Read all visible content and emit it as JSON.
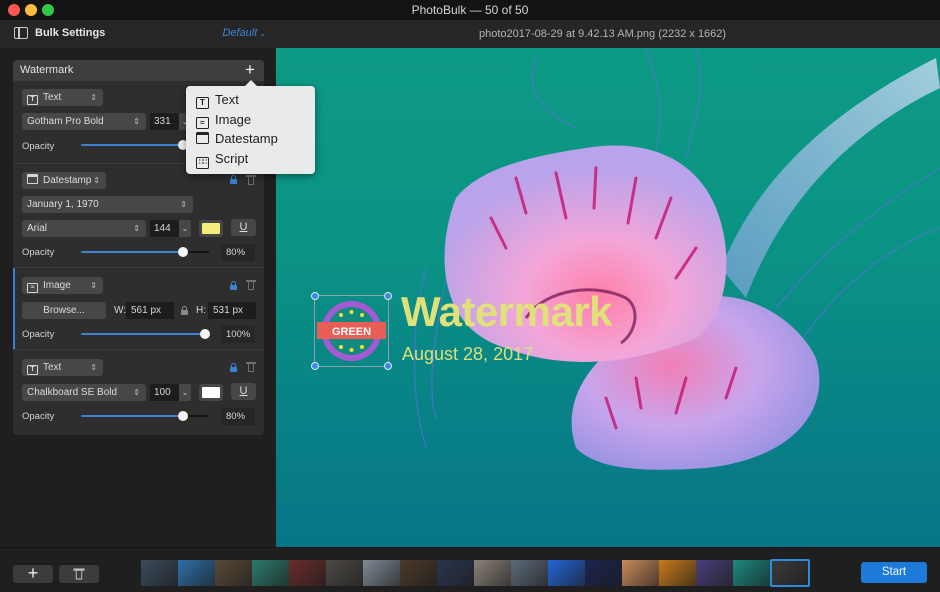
{
  "window": {
    "title": "PhotoBulk — 50 of 50"
  },
  "sidebar": {
    "title": "Bulk Settings",
    "preset": "Default",
    "panel": {
      "title": "Watermark",
      "add_button": "+",
      "layers": [
        {
          "type": "Text",
          "type_icon": "text-icon",
          "font": "Gotham Pro Bold",
          "size": "331",
          "opacity_label": "Opacity",
          "opacity": 0.8
        },
        {
          "type": "Datestamp",
          "type_icon": "calendar-icon",
          "date_format": "January 1, 1970",
          "font": "Arial",
          "size": "144",
          "color": "#f4ec7b",
          "underline_label": "U",
          "opacity_label": "Opacity",
          "opacity": 0.8,
          "opacity_text": "80%",
          "locked": true
        },
        {
          "type": "Image",
          "type_icon": "image-icon",
          "browse_label": "Browse...",
          "width_label": "W:",
          "width": "561 px",
          "height_label": "H:",
          "height": "531 px",
          "opacity_label": "Opacity",
          "opacity": 1.0,
          "opacity_text": "100%",
          "locked": true,
          "selected": true
        },
        {
          "type": "Text",
          "type_icon": "text-icon",
          "font": "Chalkboard SE Bold",
          "size": "100",
          "color": "#ffffff",
          "underline_label": "U",
          "opacity_label": "Opacity",
          "opacity": 0.8,
          "opacity_text": "80%",
          "locked": true
        }
      ]
    }
  },
  "add_menu": {
    "items": [
      {
        "label": "Text",
        "icon": "text-icon"
      },
      {
        "label": "Image",
        "icon": "image-icon"
      },
      {
        "label": "Datestamp",
        "icon": "calendar-icon"
      },
      {
        "label": "Script",
        "icon": "script-icon"
      }
    ]
  },
  "preview": {
    "file_info": "photo2017-08-29 at 9.42.13 AM.png (2232 x 1662)",
    "watermark_text": "Watermark",
    "watermark_date": "August 28, 2017",
    "badge_text": "GREEN",
    "watermark_color": "#e1e17b"
  },
  "bottombar": {
    "add_label": "+",
    "start_label": "Start",
    "thumbnail_count": 18,
    "current_index": 17,
    "accent": "#1e7ad8"
  }
}
